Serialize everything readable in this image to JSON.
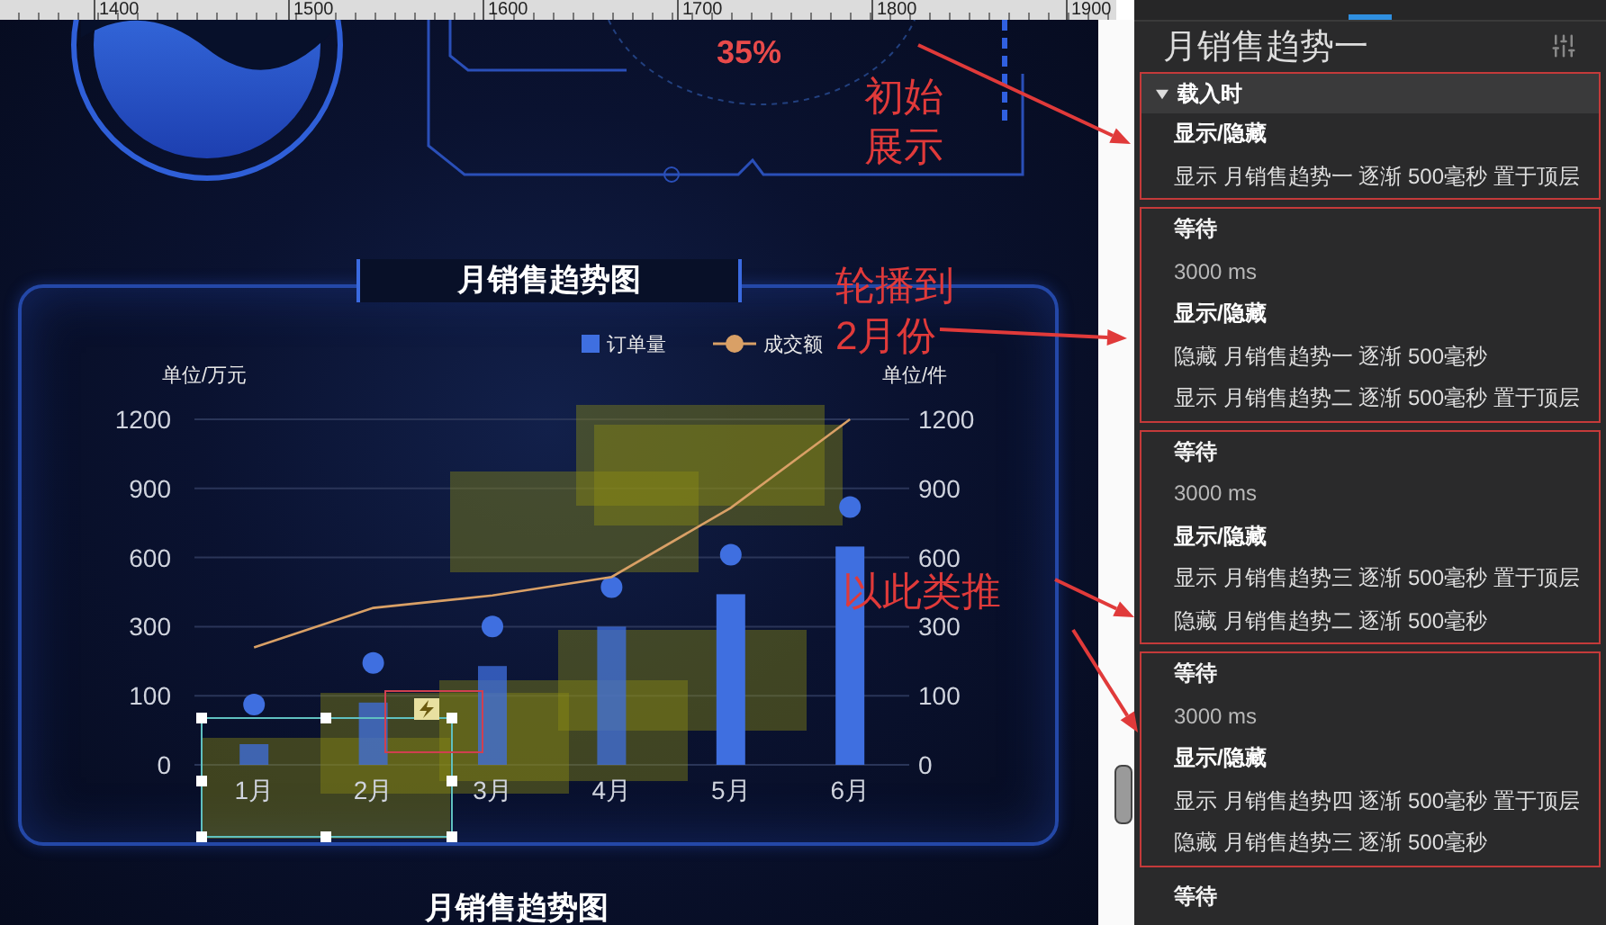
{
  "ruler": {
    "labels": [
      "1400",
      "1500",
      "1600",
      "1700",
      "1800",
      "1900"
    ]
  },
  "canvas": {
    "progress": {
      "value": "35%"
    },
    "chart": {
      "title": "月销售趋势图",
      "left_unit": "单位/万元",
      "right_unit": "单位/件",
      "legend": [
        {
          "name": "订单量",
          "kind": "bar",
          "color": "#3f6fe0"
        },
        {
          "name": "成交额",
          "kind": "line",
          "color": "#d9a066"
        }
      ],
      "y_labels": [
        "1200",
        "900",
        "600",
        "300",
        "100",
        "0"
      ],
      "y2_labels": [
        "1200",
        "900",
        "600",
        "300",
        "100",
        "0"
      ],
      "x_labels": [
        "1月",
        "2月",
        "3月",
        "4月",
        "5月",
        "6月"
      ]
    },
    "next_chart": {
      "title": "月销售趋势图"
    },
    "annotations": [
      {
        "text": "初始展示"
      },
      {
        "text": "轮播到2月份"
      },
      {
        "text": "以此类推"
      }
    ]
  },
  "panel": {
    "title": "月销售趋势一",
    "groups": [
      {
        "annotated": true,
        "trigger": {
          "label": "载入时",
          "expanded": true
        },
        "actions": [
          {
            "kind": "toggle",
            "title": "显示/隐藏",
            "lines": [
              "显示 月销售趋势一 逐渐 500毫秒 置于顶层"
            ]
          }
        ]
      },
      {
        "annotated": true,
        "actions": [
          {
            "kind": "wait",
            "title": "等待",
            "lines": [
              "3000 ms"
            ]
          },
          {
            "kind": "toggle",
            "title": "显示/隐藏",
            "lines": [
              "隐藏 月销售趋势一 逐渐 500毫秒",
              "显示 月销售趋势二 逐渐 500毫秒 置于顶层"
            ]
          }
        ]
      },
      {
        "annotated": true,
        "actions": [
          {
            "kind": "wait",
            "title": "等待",
            "lines": [
              "3000 ms"
            ]
          },
          {
            "kind": "toggle",
            "title": "显示/隐藏",
            "lines": [
              "显示 月销售趋势三 逐渐 500毫秒 置于顶层",
              "隐藏 月销售趋势二 逐渐 500毫秒"
            ]
          }
        ]
      },
      {
        "annotated": true,
        "actions": [
          {
            "kind": "wait",
            "title": "等待",
            "lines": [
              "3000 ms"
            ]
          },
          {
            "kind": "toggle",
            "title": "显示/隐藏",
            "lines": [
              "显示 月销售趋势四 逐渐 500毫秒 置于顶层",
              "隐藏 月销售趋势三 逐渐 500毫秒"
            ]
          }
        ]
      },
      {
        "annotated": false,
        "actions": [
          {
            "kind": "wait",
            "title": "等待"
          }
        ]
      }
    ]
  }
}
